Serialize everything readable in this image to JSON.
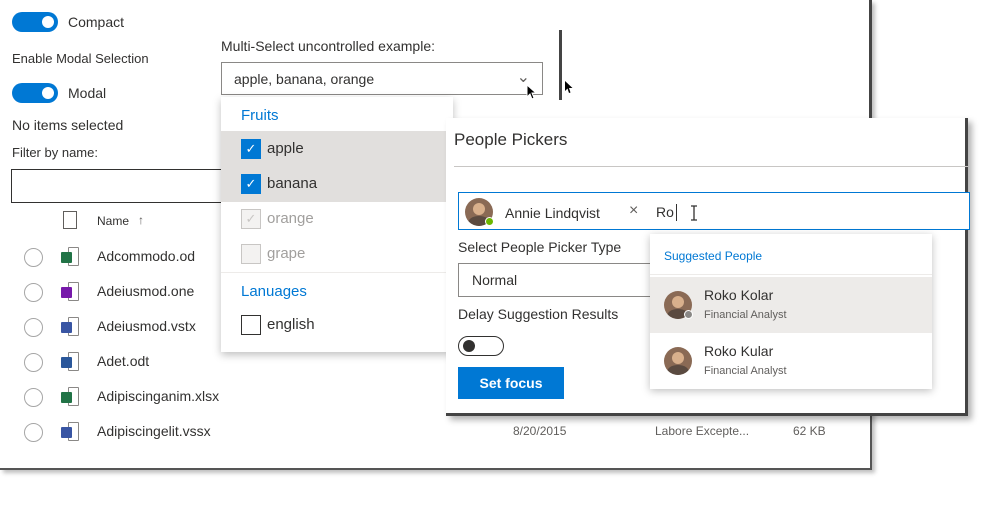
{
  "base": {
    "compact_label": "Compact",
    "enable_modal_label": "Enable Modal Selection",
    "modal_label": "Modal",
    "selection_status": "No items selected",
    "filter_label": "Filter by name:",
    "name_header": "Name",
    "sort_arrow": "↑",
    "rows": [
      {
        "name": "Adcommodo.od",
        "type": "excel",
        "date": "",
        "modified": "",
        "size": ""
      },
      {
        "name": "Adeiusmod.one",
        "type": "onenote",
        "date": "",
        "modified": "",
        "size": ""
      },
      {
        "name": "Adeiusmod.vstx",
        "type": "visio",
        "date": "",
        "modified": "",
        "size": ""
      },
      {
        "name": "Adet.odt",
        "type": "word",
        "date": "",
        "modified": "",
        "size": ""
      },
      {
        "name": "Adipiscinganim.xlsx",
        "type": "excel",
        "date": "",
        "modified": "",
        "size": ""
      },
      {
        "name": "Adipiscingelit.vssx",
        "type": "visio",
        "date": "8/20/2015",
        "modified": "Labore Excepte...",
        "size": "62 KB"
      }
    ]
  },
  "multiselect": {
    "label": "Multi-Select uncontrolled example:",
    "value": "apple, banana, orange",
    "chevron": "⌄",
    "groups": [
      {
        "header": "Fruits",
        "options": [
          {
            "label": "apple",
            "checked": true,
            "disabled": false
          },
          {
            "label": "banana",
            "checked": true,
            "disabled": false
          },
          {
            "label": "orange",
            "checked": true,
            "disabled": true
          },
          {
            "label": "grape",
            "checked": false,
            "disabled": true
          }
        ]
      },
      {
        "header": "Lanuages",
        "options": [
          {
            "label": "english",
            "checked": false,
            "disabled": false
          }
        ]
      }
    ]
  },
  "people_picker": {
    "title": "People Pickers",
    "selected_persona": "Annie Lindqvist",
    "remove_glyph": "×",
    "query": "Ro",
    "type_label": "Select People Picker Type",
    "type_value": "Normal",
    "delay_label": "Delay Suggestion Results",
    "set_focus": "Set focus",
    "suggestions_header": "Suggested People",
    "suggestions": [
      {
        "name": "Roko Kolar",
        "role": "Financial Analyst"
      },
      {
        "name": "Roko Kular",
        "role": "Financial Analyst"
      }
    ]
  },
  "colors": {
    "accent": "#0078d4",
    "presence_online": "#6bb700",
    "presence_away": "#8a8886"
  }
}
